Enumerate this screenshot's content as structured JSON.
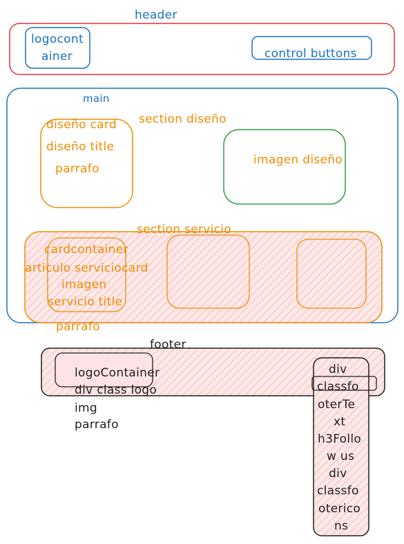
{
  "header": {
    "title": "header",
    "logo_label_1": "logocont",
    "logo_label_2": "ainer",
    "control_buttons": "control buttons"
  },
  "main": {
    "title": "main",
    "section_diseno": {
      "title": "section diseño",
      "card_title": "diseño card",
      "card_heading": "diseño title",
      "card_parrafo": "parrafo",
      "imagen": "imagen diseño"
    },
    "section_servicio": {
      "title": "section servicio",
      "cardcontainer": "cardcontainer",
      "articulo": "articulo serviciocard",
      "imagen": "imagen",
      "servicio_title": "servicio title",
      "parrafo": "parrafo"
    }
  },
  "footer": {
    "title": "footer",
    "logo_lines": [
      "logoContainer",
      "div class logo",
      "img",
      "parrafo"
    ],
    "right_lines": [
      "div",
      "classfo",
      "oterTe",
      "xt",
      "h3Follo",
      "w us",
      "div",
      "classfo",
      "oterico",
      "ns"
    ]
  },
  "colors": {
    "blue": "#1971c2",
    "red": "#e03131",
    "orange": "#f08c00",
    "green": "#2f9e44",
    "dark": "#1e1e1e",
    "pink": "#ffc9c9"
  }
}
